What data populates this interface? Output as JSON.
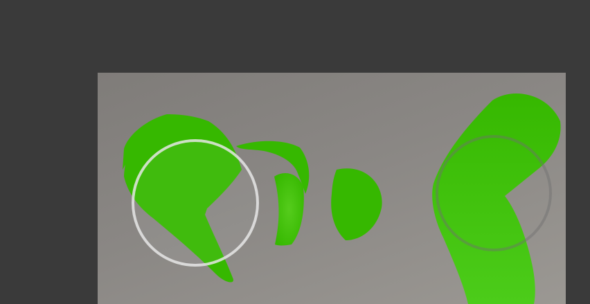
{
  "workspace": {
    "background_color": "#3a3a3a"
  },
  "canvas": {
    "background_top_color": "#7f7c79",
    "background_bottom_color": "#9b9893"
  },
  "strokes": {
    "color": "#36b800",
    "highlight_color": "#4fcf1f"
  },
  "brush_cursors": {
    "active_ring_color": "#e6e6e6",
    "inactive_ring_color": "#777777"
  }
}
